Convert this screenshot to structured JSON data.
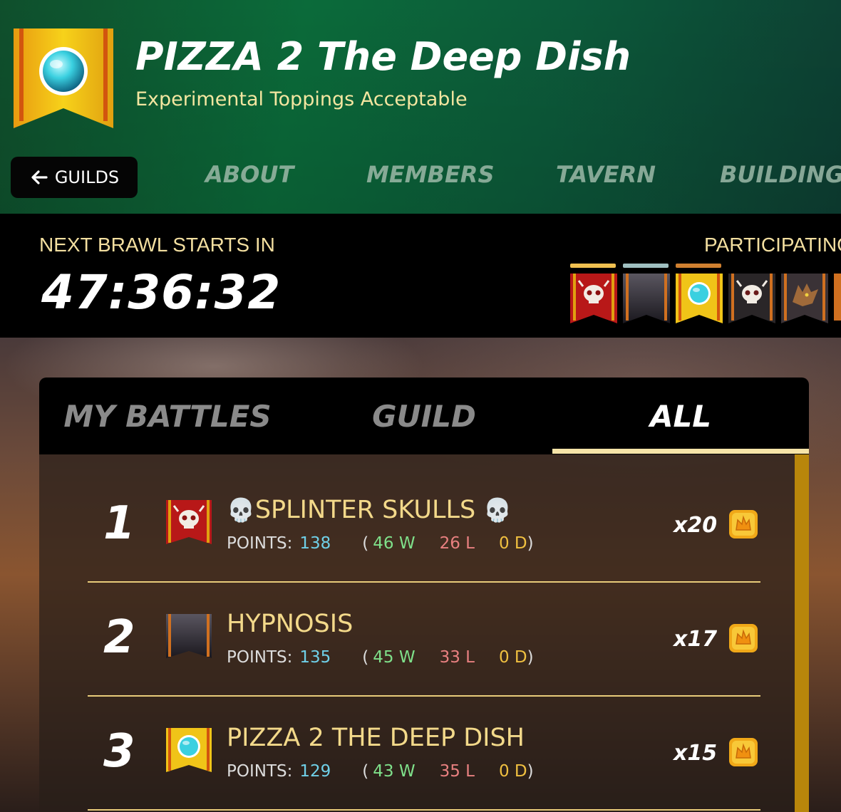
{
  "guild": {
    "name": "PIZZA 2 The Deep Dish",
    "motto": "Experimental Toppings Acceptable"
  },
  "nav": {
    "back_label": "GUILDS",
    "tabs": [
      "ABOUT",
      "MEMBERS",
      "TAVERN",
      "BUILDINGS"
    ]
  },
  "brawl": {
    "next_label": "NEXT BRAWL STARTS IN",
    "timer": "47:36:32",
    "participating_label": "PARTICIPATING"
  },
  "panel": {
    "tabs": [
      "MY BATTLES",
      "GUILD",
      "ALL"
    ],
    "active_tab": "ALL"
  },
  "rankings": [
    {
      "rank": "1",
      "name": "SPLINTER SKULLS",
      "skull_prefix": "💀",
      "skull_suffix": "💀",
      "points_label": "POINTS:",
      "points": "138",
      "wins": "46 W",
      "losses": "26 L",
      "draws": "0 D",
      "multiplier": "x20",
      "banner": "red-skull"
    },
    {
      "rank": "2",
      "name": "HYPNOSIS",
      "skull_prefix": "",
      "skull_suffix": "",
      "points_label": "POINTS:",
      "points": "135",
      "wins": "45 W",
      "losses": "33 L",
      "draws": "0 D",
      "multiplier": "x17",
      "banner": "dark"
    },
    {
      "rank": "3",
      "name": "PIZZA 2 THE DEEP DISH",
      "skull_prefix": "",
      "skull_suffix": "",
      "points_label": "POINTS:",
      "points": "129",
      "wins": "43 W",
      "losses": "35 L",
      "draws": "0 D",
      "multiplier": "x15",
      "banner": "gold-orb"
    }
  ],
  "colors": {
    "points": "#6fd0e8",
    "wins": "#7fe08a",
    "losses": "#e88080",
    "draws": "#f0c040",
    "accent": "#f6e4a8"
  }
}
